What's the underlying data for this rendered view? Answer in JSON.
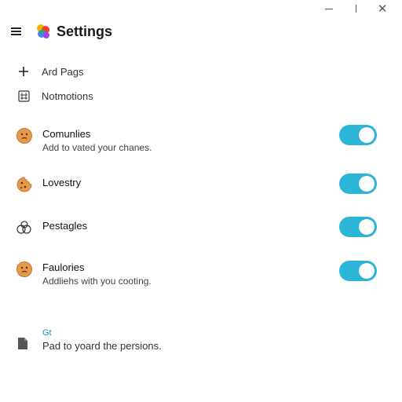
{
  "window": {
    "controls": [
      "minimize",
      "maximize",
      "close"
    ],
    "close_glyph": "✕"
  },
  "header": {
    "title": "Settings",
    "menu_icon": "hamburger-icon",
    "logo_icon": "app-logo-icon"
  },
  "menu": [
    {
      "label": "Ard Pags",
      "icon": "plus-icon"
    },
    {
      "label": "Notmotions",
      "icon": "grid-icon"
    }
  ],
  "settings": [
    {
      "title": "Comunlies",
      "description": "Add to vated your chanes.",
      "icon": "cookie-face-icon",
      "enabled": true
    },
    {
      "title": "Lovestry",
      "description": "",
      "icon": "cookie-icon",
      "enabled": true
    },
    {
      "title": "Pestagles",
      "description": "",
      "icon": "circles-icon",
      "enabled": true
    },
    {
      "title": "Faulories",
      "description": "Addliehs with you cooting.",
      "icon": "cookie-face-icon",
      "enabled": true
    }
  ],
  "footer": {
    "link": "Gt",
    "text": "Pad to yoard the persions.",
    "icon": "document-icon"
  },
  "colors": {
    "toggle_on": "#2bb5d6",
    "link": "#1a8fbf",
    "cookie": "#e49a4c"
  }
}
